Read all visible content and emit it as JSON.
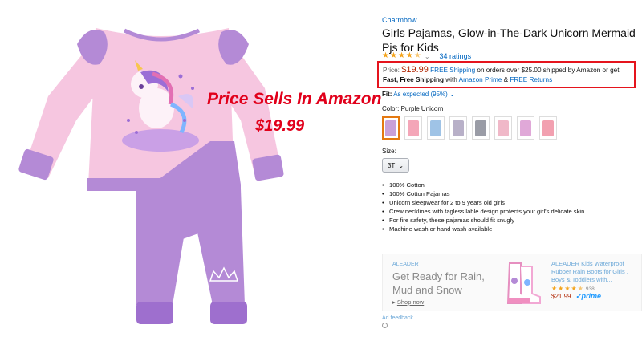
{
  "overlay": {
    "title": "Price Sells In Amazon",
    "price": "$19.99"
  },
  "product": {
    "brand": "Charmbow",
    "title": "Girls Pajamas, Glow-in-The-Dark Unicorn Mermaid Pjs for Kids",
    "rating_stars": 4.5,
    "ratings_count": "34 ratings",
    "price_label": "Price:",
    "price": "$19.99",
    "shipping_text_1": "FREE Shipping",
    "shipping_text_2": "on orders over $25.00 shipped by Amazon or get",
    "fast_free": "Fast, Free Shipping",
    "with_text": "with",
    "prime_link": "Amazon Prime",
    "amp": "&",
    "free_returns": "FREE Returns",
    "fit_label": "Fit:",
    "fit_value": "As expected (95%)",
    "color_label": "Color:",
    "color_value": "Purple Unicorn",
    "size_label": "Size:",
    "size_value": "3T",
    "bullets": [
      "100% Cotton",
      "100% Cotton Pajamas",
      "Unicorn sleepwear for 2 to 9 years old girls",
      "Crew necklines with tagless lable design protects your girl's delicate skin",
      "For fire safety, these pajamas should fit snugly",
      "Machine wash or hand wash available"
    ]
  },
  "swatches": [
    {
      "color": "#c9a0d8"
    },
    {
      "color": "#f4a6b8"
    },
    {
      "color": "#9fc3e6"
    },
    {
      "color": "#b8b0c8"
    },
    {
      "color": "#9a9ca6"
    },
    {
      "color": "#f0b8c8"
    },
    {
      "color": "#e0a8d8"
    },
    {
      "color": "#f2a0b0"
    }
  ],
  "ad": {
    "brand": "ALEADER",
    "headline": "Get Ready for Rain, Mud and Snow",
    "shop": "Shop now",
    "product_title": "ALEADER Kids Waterproof Rubber Rain Boots for Girls , Boys & Toddlers with...",
    "count": "938",
    "price": "$21.99",
    "prime": "prime",
    "feedback": "Ad feedback"
  },
  "colors": {
    "link": "#0066c0",
    "price": "#b12704",
    "overlay_red": "#e1001b",
    "highlight_border": "#e5141d",
    "star": "#f4a41c",
    "pajama_top": "#f6c6e0",
    "pajama_pants": "#b48ad6"
  }
}
